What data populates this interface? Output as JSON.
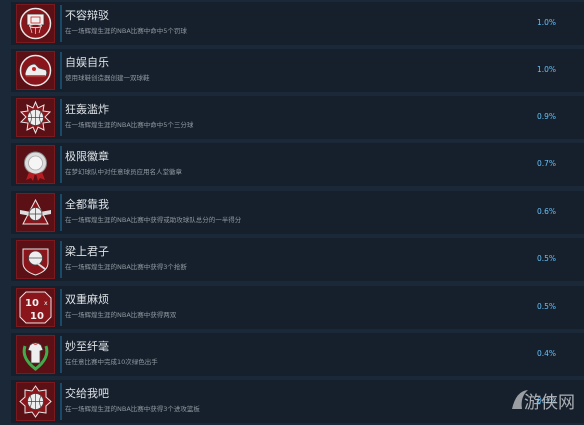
{
  "achievements": [
    {
      "title": "不容辩驳",
      "desc": "在一场辉煌生涯的NBA比赛中命中5个罚球",
      "pct": "1.0%",
      "icon": "basketball-hoop-icon"
    },
    {
      "title": "自娱自乐",
      "desc": "使用球鞋创造器创建一双球鞋",
      "pct": "1.0%",
      "icon": "sneaker-icon"
    },
    {
      "title": "狂轰滥炸",
      "desc": "在一场辉煌生涯的NBA比赛中命中5个三分球",
      "pct": "0.9%",
      "icon": "basketball-burst-icon"
    },
    {
      "title": "极限徽章",
      "desc": "在梦幻球队中对任意球员应用名人堂徽章",
      "pct": "0.7%",
      "icon": "badge-medal-icon"
    },
    {
      "title": "全都靠我",
      "desc": "在一场辉煌生涯的NBA比赛中获得或助攻球队总分的一半得分",
      "pct": "0.6%",
      "icon": "basketball-wings-icon"
    },
    {
      "title": "梁上君子",
      "desc": "在一场辉煌生涯的NBA比赛中获得3个抢断",
      "pct": "0.5%",
      "icon": "steal-ball-icon"
    },
    {
      "title": "双重麻烦",
      "desc": "在一场辉煌生涯的NBA比赛中获得两双",
      "pct": "0.5%",
      "icon": "double-double-icon"
    },
    {
      "title": "妙至纤毫",
      "desc": "在任意比赛中完成10次绿色出手",
      "pct": "0.4%",
      "icon": "jersey-wreath-icon"
    },
    {
      "title": "交给我吧",
      "desc": "在一场辉煌生涯的NBA比赛中获得3个进攻篮板",
      "pct": "0.3%",
      "icon": "rebound-ball-icon"
    }
  ],
  "watermark": {
    "text": "游侠网"
  },
  "colors": {
    "background": "#1b2838",
    "row": "#16202d",
    "percent": "#66c0f4",
    "icon_bg": "#4a0d10"
  }
}
